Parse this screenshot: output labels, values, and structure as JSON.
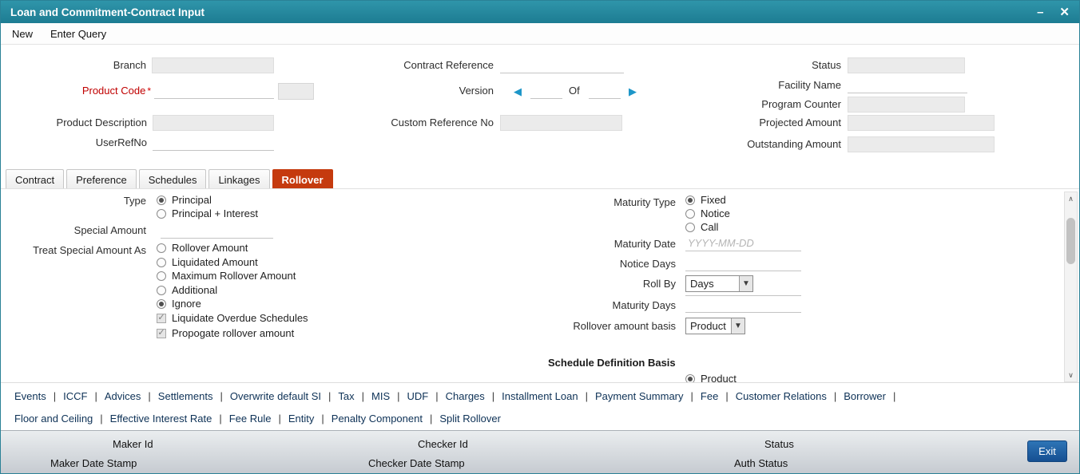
{
  "window": {
    "title": "Loan and Commitment-Contract Input"
  },
  "icons": {
    "minimize": "–",
    "close": "✕",
    "prev_arrow": "◀",
    "next_arrow": "▶",
    "check": "✓",
    "select_arrow": "▼",
    "scroll_up": "∧",
    "scroll_down": "∨",
    "panel_toggle": "∨"
  },
  "menu": {
    "items": [
      "New",
      "Enter Query"
    ]
  },
  "header_fields": {
    "branch": {
      "label": "Branch",
      "value": ""
    },
    "contract_reference": {
      "label": "Contract Reference",
      "value": ""
    },
    "status": {
      "label": "Status",
      "value": ""
    },
    "product_code": {
      "label": "Product Code",
      "required": "*",
      "value": ""
    },
    "version": {
      "label": "Version",
      "of_label": "Of",
      "current": "",
      "total": ""
    },
    "facility_name": {
      "label": "Facility Name",
      "value": ""
    },
    "program_counter": {
      "label": "Program Counter",
      "value": ""
    },
    "product_description": {
      "label": "Product Description",
      "value": ""
    },
    "custom_reference_no": {
      "label": "Custom Reference No",
      "value": ""
    },
    "projected_amount": {
      "label": "Projected Amount",
      "value": ""
    },
    "user_ref_no": {
      "label": "UserRefNo",
      "value": ""
    },
    "outstanding_amount": {
      "label": "Outstanding Amount",
      "value": ""
    }
  },
  "tabs": [
    {
      "label": "Contract",
      "active": false
    },
    {
      "label": "Preference",
      "active": false
    },
    {
      "label": "Schedules",
      "active": false
    },
    {
      "label": "Linkages",
      "active": false
    },
    {
      "label": "Rollover",
      "active": true
    }
  ],
  "rollover_tab": {
    "type_group": {
      "label": "Type",
      "options": [
        {
          "label": "Principal",
          "selected": true
        },
        {
          "label": "Principal + Interest",
          "selected": false
        }
      ]
    },
    "special_amount": {
      "label": "Special Amount",
      "value": ""
    },
    "treat_special_group": {
      "label": "Treat Special Amount As",
      "options": [
        {
          "label": "Rollover Amount",
          "selected": false
        },
        {
          "label": "Liquidated Amount",
          "selected": false
        },
        {
          "label": "Maximum Rollover Amount",
          "selected": false
        },
        {
          "label": "Additional",
          "selected": false
        },
        {
          "label": "Ignore",
          "selected": true
        }
      ]
    },
    "checkboxes": [
      {
        "label": "Liquidate Overdue Schedules",
        "checked": true
      },
      {
        "label": "Propogate rollover amount",
        "checked": true
      }
    ],
    "maturity_type_group": {
      "label": "Maturity Type",
      "options": [
        {
          "label": "Fixed",
          "selected": true
        },
        {
          "label": "Notice",
          "selected": false
        },
        {
          "label": "Call",
          "selected": false
        }
      ]
    },
    "maturity_date": {
      "label": "Maturity Date",
      "placeholder": "YYYY-MM-DD",
      "value": ""
    },
    "notice_days": {
      "label": "Notice Days",
      "value": ""
    },
    "roll_by": {
      "label": "Roll By",
      "value": "Days"
    },
    "maturity_days": {
      "label": "Maturity Days",
      "value": ""
    },
    "rollover_amount_basis": {
      "label": "Rollover amount basis",
      "value": "Product"
    },
    "schedule_definition_basis_title": "Schedule Definition Basis",
    "partial_option": {
      "label": "Product",
      "selected": true
    }
  },
  "action_links": {
    "separator": "|",
    "row1": [
      "Events",
      "ICCF",
      "Advices",
      "Settlements",
      "Overwrite default SI",
      "Tax",
      "MIS",
      "UDF",
      "Charges",
      "Installment Loan",
      "Payment Summary",
      "Fee",
      "Customer Relations",
      "Borrower"
    ],
    "row2": [
      "Floor and Ceiling",
      "Effective Interest Rate",
      "Fee Rule",
      "Entity",
      "Penalty Component",
      "Split Rollover"
    ]
  },
  "footer": {
    "maker_id": "Maker Id",
    "checker_id": "Checker Id",
    "status": "Status",
    "maker_date_stamp": "Maker Date Stamp",
    "checker_date_stamp": "Checker Date Stamp",
    "auth_status": "Auth Status",
    "exit_label": "Exit"
  },
  "colors": {
    "titlebar": "#24889d",
    "active_tab": "#c53a0e",
    "link_text": "#0d3156",
    "exit_button": "#1c5ca0",
    "required": "#c00000"
  }
}
